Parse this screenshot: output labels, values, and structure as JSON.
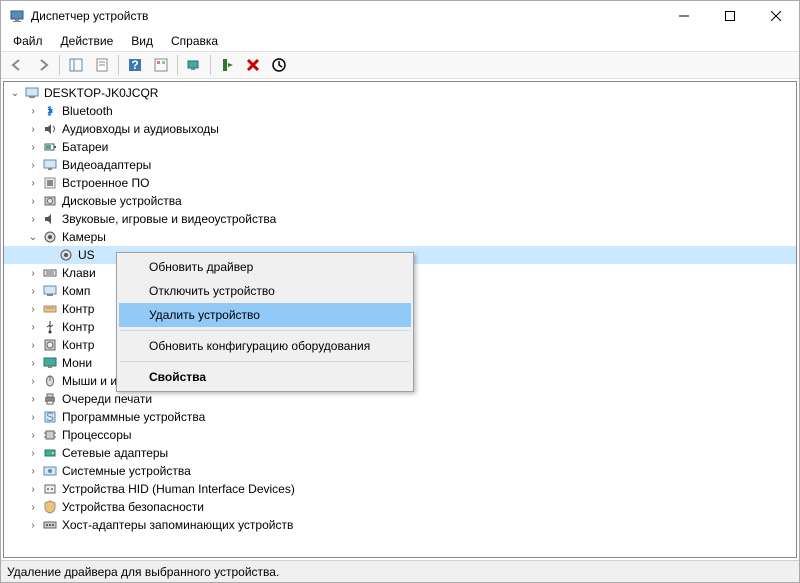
{
  "window": {
    "title": "Диспетчер устройств"
  },
  "menu": {
    "file": "Файл",
    "action": "Действие",
    "view": "Вид",
    "help": "Справка"
  },
  "tree": {
    "root": "DESKTOP-JK0JCQR",
    "items": [
      {
        "label": "Bluetooth",
        "icon": "bluetooth"
      },
      {
        "label": "Аудиовходы и аудиовыходы",
        "icon": "audio"
      },
      {
        "label": "Батареи",
        "icon": "battery"
      },
      {
        "label": "Видеоадаптеры",
        "icon": "display"
      },
      {
        "label": "Встроенное ПО",
        "icon": "firmware"
      },
      {
        "label": "Дисковые устройства",
        "icon": "disk"
      },
      {
        "label": "Звуковые, игровые и видеоустройства",
        "icon": "sound"
      },
      {
        "label": "Камеры",
        "icon": "camera",
        "expanded": true,
        "children": [
          {
            "label": "US",
            "icon": "camera",
            "selected": true
          }
        ]
      },
      {
        "label": "Клави",
        "icon": "keyboard"
      },
      {
        "label": "Комп",
        "icon": "computer"
      },
      {
        "label": "Контр",
        "icon": "ide"
      },
      {
        "label": "Контр",
        "icon": "usb"
      },
      {
        "label": "Контр",
        "icon": "storage"
      },
      {
        "label": "Мони",
        "icon": "monitor"
      },
      {
        "label": "Мыши и иные указывающие устройства",
        "icon": "mouse"
      },
      {
        "label": "Очереди печати",
        "icon": "printer"
      },
      {
        "label": "Программные устройства",
        "icon": "software"
      },
      {
        "label": "Процессоры",
        "icon": "cpu"
      },
      {
        "label": "Сетевые адаптеры",
        "icon": "network"
      },
      {
        "label": "Системные устройства",
        "icon": "system"
      },
      {
        "label": "Устройства HID (Human Interface Devices)",
        "icon": "hid"
      },
      {
        "label": "Устройства безопасности",
        "icon": "security"
      },
      {
        "label": "Хост-адаптеры запоминающих устройств",
        "icon": "hba"
      }
    ]
  },
  "context_menu": {
    "update_driver": "Обновить драйвер",
    "disable_device": "Отключить устройство",
    "uninstall_device": "Удалить устройство",
    "scan_hardware": "Обновить конфигурацию оборудования",
    "properties": "Свойства"
  },
  "status": "Удаление драйвера для выбранного устройства."
}
